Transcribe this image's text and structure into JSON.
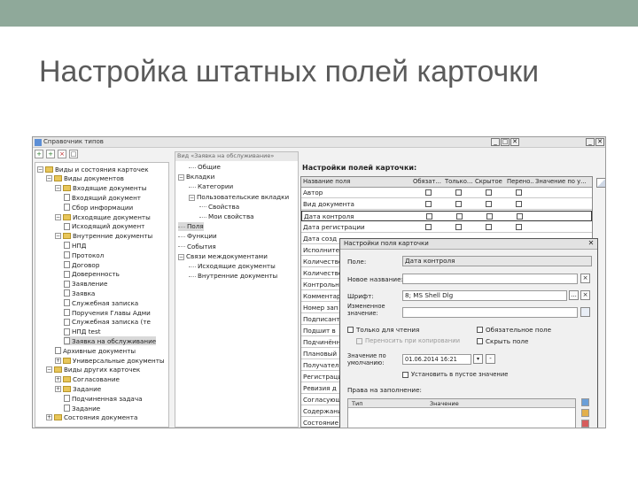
{
  "slide": {
    "title": "Настройка штатных полей карточки"
  },
  "window": {
    "title": "Справочник типов",
    "btn_min": "_",
    "btn_max": "□",
    "btn_close": "✕"
  },
  "toolbar": {
    "add": "+",
    "btn2": "+",
    "btn3": "×",
    "btn4": "□"
  },
  "tree": {
    "items": [
      {
        "label": "Виды и состояния карточек",
        "exp": "−"
      },
      {
        "label": "Виды документов",
        "exp": "−"
      },
      {
        "label": "Входящие документы",
        "exp": "−"
      },
      {
        "label": "Входящий документ"
      },
      {
        "label": "Сбор информации"
      },
      {
        "label": "Исходящие документы",
        "exp": "−"
      },
      {
        "label": "Исходящий документ"
      },
      {
        "label": "Внутренние документы",
        "exp": "−"
      },
      {
        "label": "НПД"
      },
      {
        "label": "Протокол"
      },
      {
        "label": "Договор"
      },
      {
        "label": "Доверенность"
      },
      {
        "label": "Заявление"
      },
      {
        "label": "Заявка"
      },
      {
        "label": "Служебная записка"
      },
      {
        "label": "Поручения Главы Адми"
      },
      {
        "label": "Служебная записка (те"
      },
      {
        "label": "НПД test"
      },
      {
        "label": "Заявка на обслуживание"
      },
      {
        "label": "Архивные документы"
      },
      {
        "label": "Универсальные документы",
        "exp": "+"
      },
      {
        "label": "Виды других карточек",
        "exp": "−"
      },
      {
        "label": "Согласование",
        "exp": "+"
      },
      {
        "label": "Задание",
        "exp": "+"
      },
      {
        "label": "Подчиненная задача"
      },
      {
        "label": "Задание"
      },
      {
        "label": "Состояния документа",
        "exp": "+"
      }
    ]
  },
  "center": {
    "header": "Вид «Заявка на обслуживание»",
    "items": [
      {
        "label": "Общие"
      },
      {
        "label": "Вкладки",
        "exp": "−"
      },
      {
        "label": "Категории"
      },
      {
        "label": "Пользовательские вкладки",
        "exp": "−"
      },
      {
        "label": "Свойства"
      },
      {
        "label": "Мои свойства"
      },
      {
        "label": "Поля"
      },
      {
        "label": "Функции"
      },
      {
        "label": "События"
      },
      {
        "label": "Связи междокументами",
        "exp": "−"
      },
      {
        "label": "Исходящие документы"
      },
      {
        "label": "Внутренние документы"
      }
    ]
  },
  "fields_panel": {
    "title": "Настройки полей карточки:",
    "columns": [
      "Название поля",
      "Обязат...",
      "Только...",
      "Скрытое",
      "Перено...",
      "Значение по у..."
    ],
    "rows": [
      "Автор",
      "Вид документа",
      "Дата контроля",
      "Дата регистрации",
      "Дата созд",
      "Исполнитель",
      "Количество",
      "Количество",
      "Контрольный",
      "Комментарий",
      "Номер зап",
      "Подписант",
      "Подшит в",
      "Подчинённый",
      "Плановый",
      "Получатель",
      "Регистрация",
      "Ревизия д",
      "Согласующие",
      "Содержание",
      "Состояние"
    ]
  },
  "dialog": {
    "title": "Настройки поля карточки",
    "close": "✕",
    "field_label": "Поле:",
    "field_value": "Дата контроля",
    "new_name_label": "Новое название:",
    "new_name_value": "",
    "new_name_btn": "×",
    "font_label": "Шрифт:",
    "font_value": "8; MS Shell Dlg",
    "font_btn1": "...",
    "font_btn2": "×",
    "changed_label": "Измененное значение:",
    "changed_value": "",
    "readonly_label": "Только для чтения",
    "required_label": "Обязательное поле",
    "transfer_label": "Переносить при копировании",
    "hidden_label": "Скрыть поле",
    "default_label": "Значение по умолчанию:",
    "default_value": "01.06.2014 16:21",
    "default_btn": "-",
    "set_if_empty_label": "Установить в пустое значение",
    "perm_title": "Права на заполнение:",
    "perm_col1": "Тип",
    "perm_col2": "Значение"
  }
}
